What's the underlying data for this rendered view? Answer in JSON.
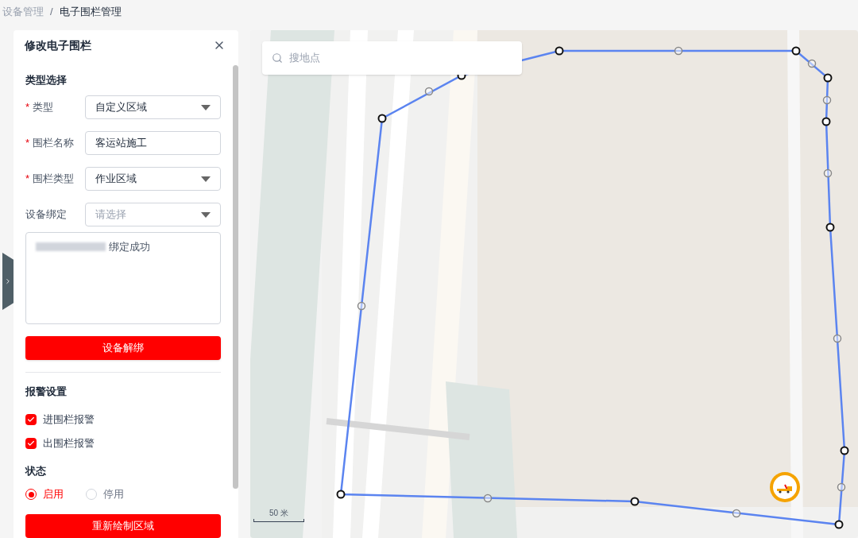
{
  "breadcrumb": [
    {
      "label": "设备管理",
      "current": false
    },
    {
      "label": "电子围栏管理",
      "current": true
    }
  ],
  "separator": "/",
  "required_mark": "*",
  "panel": {
    "title": "修改电子围栏",
    "type_section": {
      "heading": "类型选择",
      "fields": [
        {
          "kind": "select",
          "label": "类型",
          "required": true,
          "value": "自定义区域"
        },
        {
          "kind": "input",
          "label": "围栏名称",
          "required": true,
          "value": "客运站施工"
        },
        {
          "kind": "select",
          "label": "围栏类型",
          "required": true,
          "value": "作业区域"
        },
        {
          "kind": "select",
          "label": "设备绑定",
          "required": false,
          "placeholder": "请选择"
        }
      ],
      "binding_log": "绑定成功",
      "unbind_button": "设备解绑"
    },
    "alarm_section": {
      "heading": "报警设置",
      "options": [
        {
          "label": "进围栏报警",
          "checked": true
        },
        {
          "label": "出围栏报警",
          "checked": true
        }
      ]
    },
    "status_section": {
      "heading": "状态",
      "options": [
        {
          "label": "启用",
          "selected": true
        },
        {
          "label": "停用",
          "selected": false
        }
      ]
    },
    "redraw_button": "重新绘制区域"
  },
  "map": {
    "search": {
      "placeholder": "搜地点"
    },
    "scale": "50 米"
  }
}
